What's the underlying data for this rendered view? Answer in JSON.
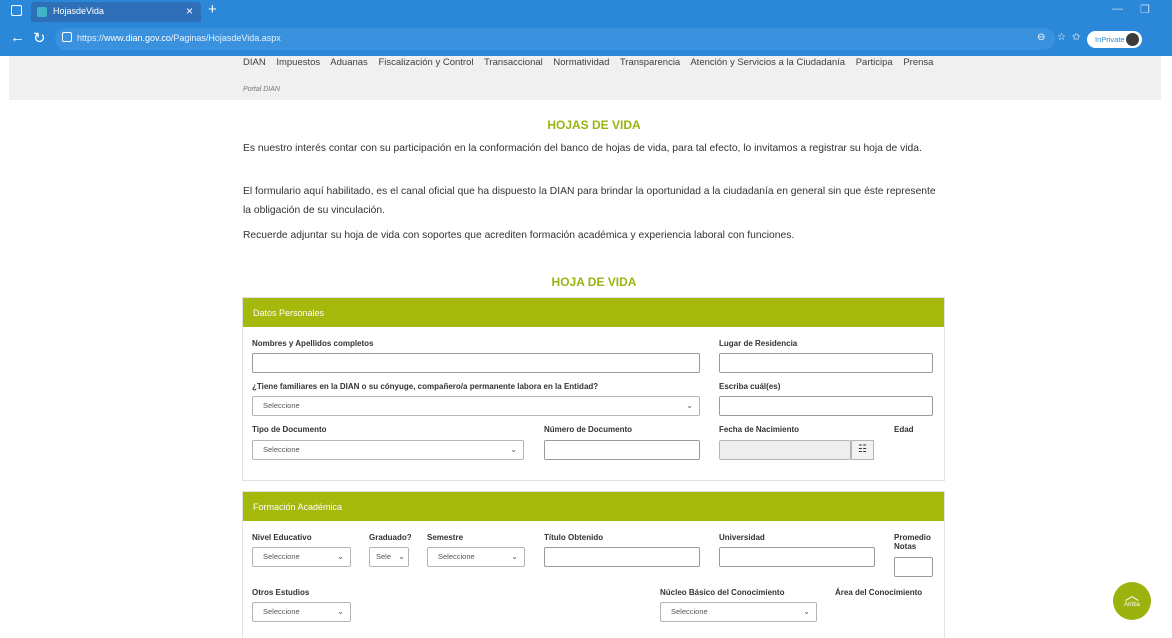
{
  "browser": {
    "tab_title": "HojasdeVida",
    "new_tab": "+",
    "close_tab": "×",
    "url_prefix": "https://",
    "url_host": "www.dian.gov.co",
    "url_path": "/Paginas/HojasdeVida.aspx",
    "badge": "InPrivate"
  },
  "menu": {
    "items": [
      "DIAN",
      "Impuestos",
      "Aduanas",
      "Fiscalización y Control",
      "Transaccional",
      "Normatividad",
      "Transparencia",
      "Atención y Servicios a la Ciudadanía",
      "Participa",
      "Prensa"
    ]
  },
  "breadcrumb": "Portal DIAN",
  "intro": {
    "title": "HOJAS DE VIDA",
    "p1": "Es nuestro interés contar con su participación en la conformación del banco de hojas de vida, para tal efecto, lo invitamos a registrar su hoja de vida.",
    "p2": "El formulario aquí habilitado, es el canal oficial que ha dispuesto la DIAN para brindar la oportunidad a la ciudadanía en general sin que éste represente la obligación de su vinculación.",
    "p3": "Recuerde adjuntar su hoja de vida con soportes que acrediten formación académica y experiencia laboral con funciones."
  },
  "form": {
    "title": "HOJA DE VIDA",
    "personal": {
      "header": "Datos Personales",
      "nombres_label": "Nombres y Apellidos completos",
      "residencia_label": "Lugar de Residencia",
      "familiares_label": "¿Tiene familiares en la DIAN o su cónyuge, compañero/a permanente labora en la Entidad?",
      "familiares_value": "Seleccione",
      "cuales_label": "Escriba cuál(es)",
      "tipo_doc_label": "Tipo de Documento",
      "tipo_doc_value": "Seleccione",
      "num_doc_label": "Número de Documento",
      "fecha_label": "Fecha de Nacimiento",
      "edad_label": "Edad"
    },
    "academica": {
      "header": "Formación Académica",
      "nivel_label": "Nivel Educativo",
      "nivel_value": "Seleccione",
      "graduado_label": "Graduado?",
      "graduado_value": "Sele",
      "semestre_label": "Semestre",
      "semestre_value": "Seleccione",
      "titulo_label": "Título Obtenido",
      "universidad_label": "Universidad",
      "promedio_label_1": "Promedio",
      "promedio_label_2": "Notas",
      "otros_label": "Otros Estudios",
      "otros_value": "Seleccione",
      "nucleo_label": "Núcleo Básico del Conocimiento",
      "nucleo_value": "Seleccione",
      "area_label": "Área del Conocimiento"
    }
  },
  "back_to_top": "Arriba"
}
